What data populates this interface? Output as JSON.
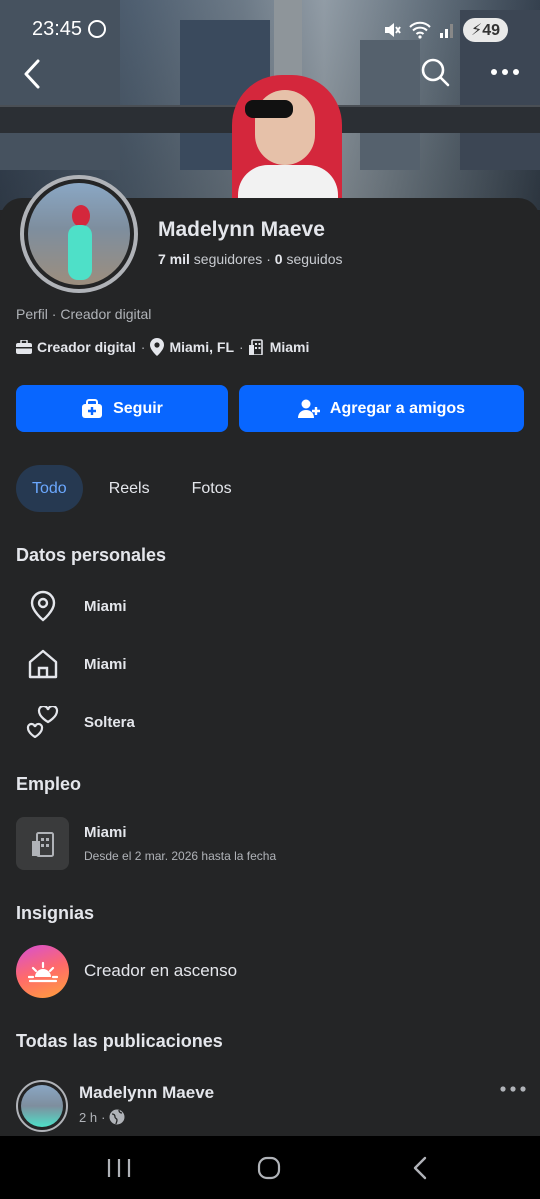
{
  "status_bar": {
    "time": "23:45",
    "battery": "49"
  },
  "profile": {
    "name": "Madelynn Maeve",
    "followers_count": "7 mil",
    "followers_label": "seguidores",
    "following_count": "0",
    "following_label": "seguidos",
    "category_line": "Perfil · Creador digital",
    "chips": {
      "category": "Creador digital",
      "location": "Miami, FL",
      "workplace": "Miami",
      "separator": "·"
    }
  },
  "actions": {
    "follow_label": "Seguir",
    "add_friend_label": "Agregar a amigos"
  },
  "tabs": [
    {
      "label": "Todo",
      "active": true
    },
    {
      "label": "Reels",
      "active": false
    },
    {
      "label": "Fotos",
      "active": false
    }
  ],
  "personal": {
    "title": "Datos personales",
    "items": [
      {
        "icon": "location-pin-icon",
        "label": "Miami"
      },
      {
        "icon": "home-icon",
        "label": "Miami"
      },
      {
        "icon": "hearts-icon",
        "label": "Soltera"
      }
    ]
  },
  "employment": {
    "title": "Empleo",
    "place": "Miami",
    "dates": "Desde el 2 mar. 2026 hasta la fecha"
  },
  "badges": {
    "title": "Insignias",
    "item": "Creador en ascenso"
  },
  "posts": {
    "title": "Todas las publicaciones",
    "author": "Madelynn Maeve",
    "time": "2 h",
    "separator": "·"
  },
  "colors": {
    "accent": "#0866ff",
    "background": "#242526",
    "tab_active_bg": "#263951"
  }
}
